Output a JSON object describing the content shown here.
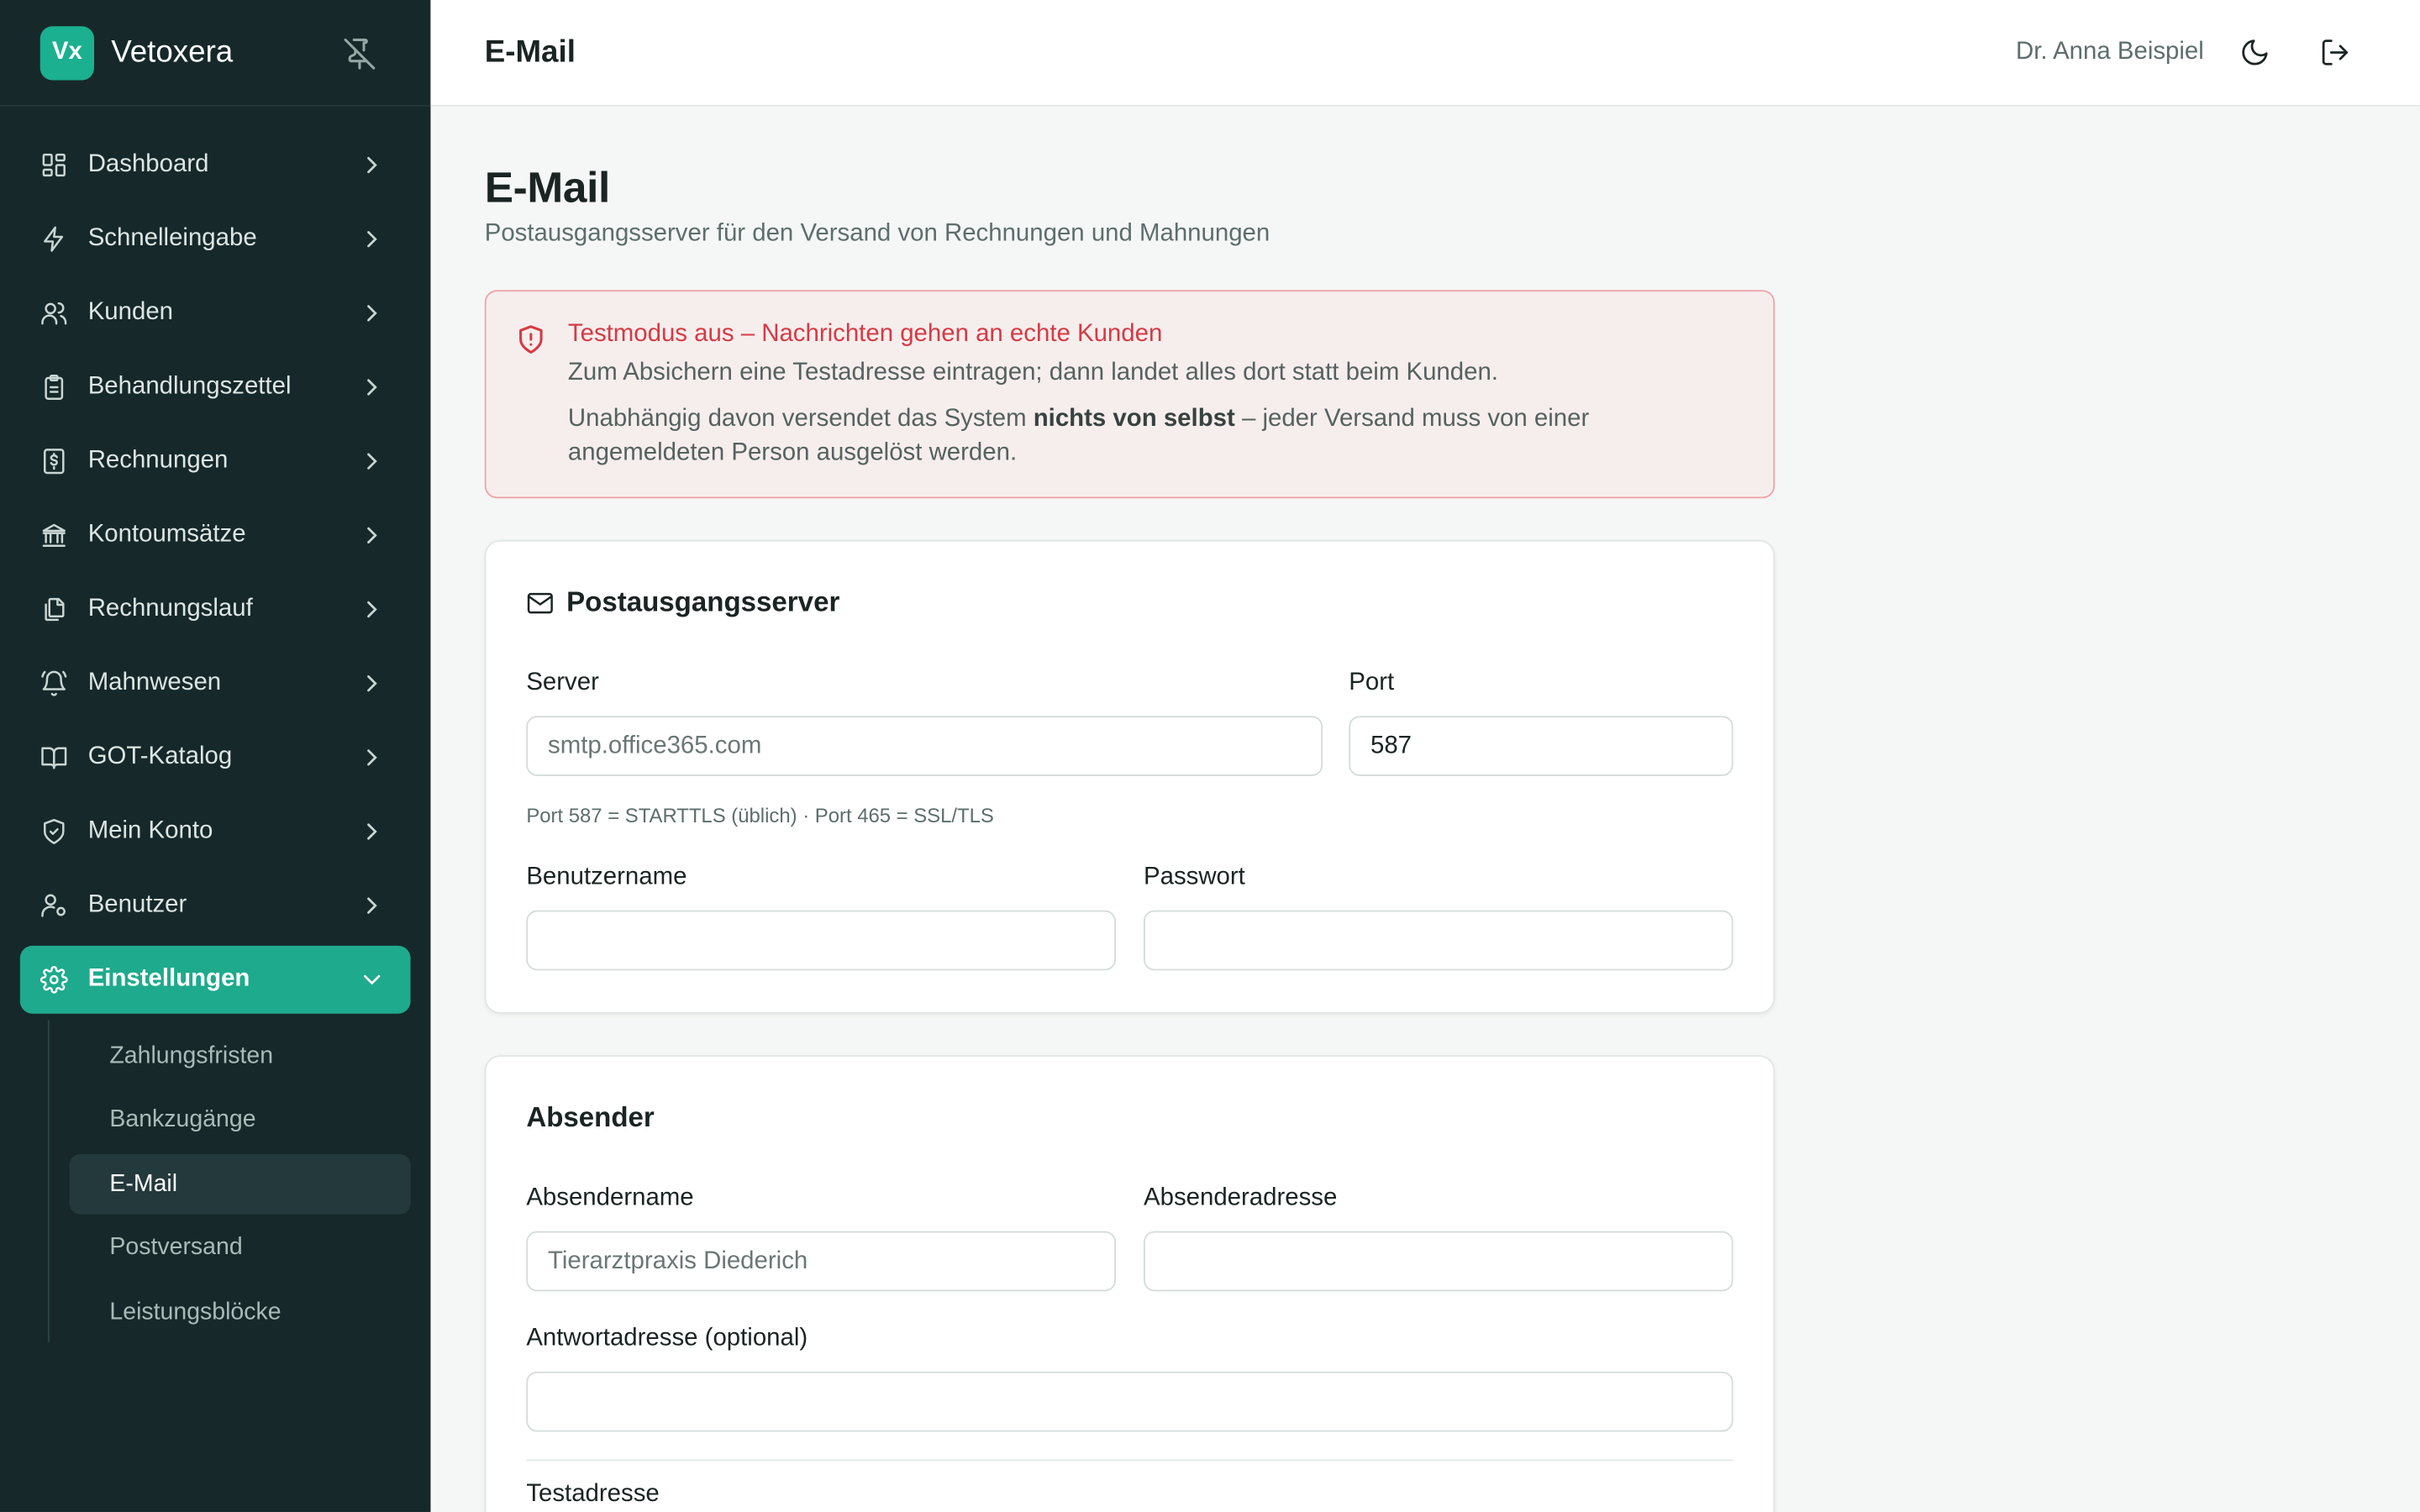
{
  "brand": {
    "logo": "Vx",
    "name": "Vetoxera"
  },
  "sidebar": {
    "items": [
      {
        "label": "Dashboard",
        "icon": "dashboard-icon"
      },
      {
        "label": "Schnelleingabe",
        "icon": "lightning-icon"
      },
      {
        "label": "Kunden",
        "icon": "users-icon"
      },
      {
        "label": "Behandlungszettel",
        "icon": "clipboard-icon"
      },
      {
        "label": "Rechnungen",
        "icon": "receipt-icon"
      },
      {
        "label": "Kontoumsätze",
        "icon": "bank-icon"
      },
      {
        "label": "Rechnungslauf",
        "icon": "documents-icon"
      },
      {
        "label": "Mahnwesen",
        "icon": "bell-icon"
      },
      {
        "label": "GOT-Katalog",
        "icon": "book-icon"
      },
      {
        "label": "Mein Konto",
        "icon": "shield-icon"
      },
      {
        "label": "Benutzer",
        "icon": "user-settings-icon"
      },
      {
        "label": "Einstellungen",
        "icon": "gear-icon"
      }
    ],
    "sub_items": [
      "Zahlungsfristen",
      "Bankzugänge",
      "E-Mail",
      "Postversand",
      "Leistungsblöcke"
    ],
    "selected_sub": "E-Mail"
  },
  "header": {
    "title": "E-Mail",
    "user": "Dr. Anna Beispiel"
  },
  "page": {
    "title": "E-Mail",
    "subtitle": "Postausgangsserver für den Versand von Rechnungen und Mahnungen"
  },
  "alert": {
    "title": "Testmodus aus – Nachrichten gehen an echte Kunden",
    "line1": "Zum Absichern eine Testadresse eintragen; dann landet alles dort statt beim Kunden.",
    "line2_pre": "Unabhängig davon versendet das System ",
    "line2_bold": "nichts von selbst",
    "line2_post": " – jeder Versand muss von einer angemeldeten Person ausgelöst werden."
  },
  "server_card": {
    "title": "Postausgangsserver",
    "server_label": "Server",
    "server_placeholder": "smtp.office365.com",
    "port_label": "Port",
    "port_value": "587",
    "hint": "Port 587 = STARTTLS (üblich) · Port 465 = SSL/TLS",
    "username_label": "Benutzername",
    "password_label": "Passwort"
  },
  "sender_card": {
    "title": "Absender",
    "name_label": "Absendername",
    "name_placeholder": "Tierarztpraxis Diederich",
    "address_label": "Absenderadresse",
    "reply_label": "Antwortadresse (optional)",
    "test_label": "Testadresse"
  },
  "colors": {
    "sidebar_bg": "#16282a",
    "accent": "#1eaa8c",
    "alert_text": "#d63a44"
  }
}
